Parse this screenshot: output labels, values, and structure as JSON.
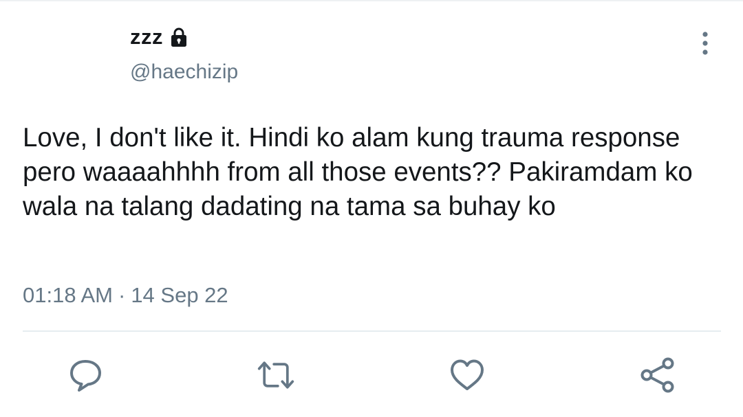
{
  "tweet": {
    "display_name": "zzz",
    "handle": "@haechizip",
    "protected_icon": "lock-icon",
    "text": "Love, I don't like it. Hindi ko alam kung trauma response pero waaaahhhh from all those events?? Pakiramdam ko wala na talang dadating na tama sa buhay ko",
    "time": "01:18 AM",
    "separator": "·",
    "date": "14 Sep 22"
  },
  "actions": {
    "reply_icon": "reply-icon",
    "retweet_icon": "retweet-icon",
    "like_icon": "heart-icon",
    "share_icon": "share-icon",
    "more_icon": "more-vertical-icon"
  },
  "colors": {
    "text_primary": "#14171a",
    "text_secondary": "#657786",
    "divider": "#e6ecf0"
  }
}
